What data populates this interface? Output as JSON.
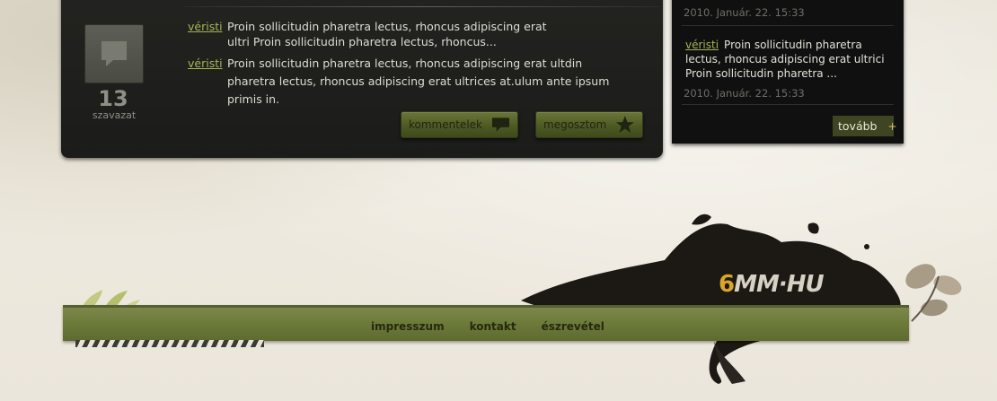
{
  "post": {
    "vote_count": "13",
    "vote_label": "szavazat",
    "comments": [
      {
        "author": "véristi",
        "text": "Proin sollicitudin pharetra lectus, rhoncus adipiscing erat ultri Proin sollicitudin pharetra lectus, rhoncus..."
      },
      {
        "author": "véristi",
        "text": "Proin sollicitudin pharetra lectus, rhoncus adipiscing erat ultdin pharetra lectus, rhoncus adipiscing erat ultrices at.ulum ante ipsum primis in."
      }
    ],
    "comments_button": "kommentelek",
    "share_button": "megosztom"
  },
  "sidebar": {
    "top_date": "2010. Január. 22. 15:33",
    "comment": {
      "author": "véristi",
      "text": "Proin sollicitudin pharetra lectus, rhoncus adipiscing erat ultrici Proin sollicitudin pharetra ..."
    },
    "comment_date": "2010. Január. 22. 15:33",
    "more_button": "tovább",
    "more_plus": "+"
  },
  "footer": {
    "logo_six": "6",
    "logo_rest": "MM·HU",
    "nav": [
      "impresszum",
      "kontakt",
      "észrevétel"
    ]
  },
  "colors": {
    "accent_green": "#a7b456",
    "button_green": "#4d5a23",
    "logo_orange": "#d9a52a",
    "footer_green": "#6c7a3a"
  },
  "icons": [
    "comment-icon",
    "speech-bubble-icon",
    "star-icon",
    "plus-icon"
  ]
}
